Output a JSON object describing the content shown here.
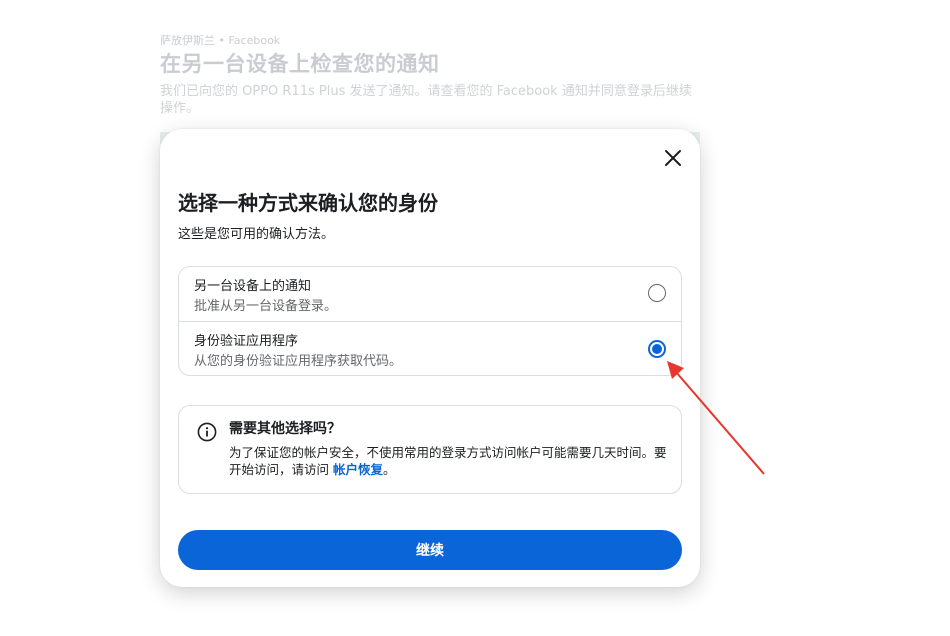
{
  "background": {
    "breadcrumb": "萨放伊斯兰 • Facebook",
    "title": "在另一台设备上检查您的通知",
    "description": "我们已向您的 OPPO R11s Plus 发送了通知。请查看您的 Facebook 通知并同意登录后继续操作。"
  },
  "modal": {
    "title": "选择一种方式来确认您的身份",
    "subtitle": "这些是您可用的确认方法。",
    "options": [
      {
        "title": "另一台设备上的通知",
        "description": "批准从另一台设备登录。",
        "selected": false
      },
      {
        "title": "身份验证应用程序",
        "description": "从您的身份验证应用程序获取代码。",
        "selected": true
      }
    ],
    "info": {
      "title": "需要其他选择吗？",
      "text_before": "为了保证您的帐户安全，不使用常用的登录方式访问帐户可能需要几天时间。要开始访问，请访问 ",
      "link": "帐户恢复",
      "text_after": "。"
    },
    "continue_label": "继续"
  },
  "colors": {
    "primary": "#0a66d8",
    "annotation": "#e8372f"
  },
  "icons": {
    "close": "close-icon",
    "info": "info-icon"
  }
}
